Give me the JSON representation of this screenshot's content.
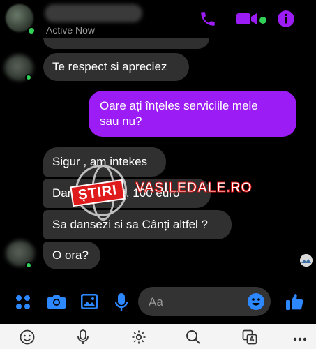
{
  "header": {
    "status": "Active Now",
    "online_color": "#31d158",
    "accent_color": "#9b1cf5",
    "icons": [
      "phone-icon",
      "video-icon",
      "info-icon"
    ]
  },
  "messages": [
    {
      "direction": "in",
      "text": "Te respect si apreciez"
    },
    {
      "direction": "out",
      "text": "Oare ați înțeles serviciile mele sau nu?"
    },
    {
      "direction": "in",
      "text": "Sigur , am intekes"
    },
    {
      "direction": "in",
      "text": "Dansu... ...ofe, 100 euro"
    },
    {
      "direction": "in",
      "text": "Sa dansezi si sa Cânți altfel ?"
    },
    {
      "direction": "in",
      "text": "O ora?"
    }
  ],
  "watermark": {
    "badge": "ȘTIRI",
    "site": "VASILEDALE.RO",
    "badge_color": "#e01b1b"
  },
  "composer": {
    "placeholder": "Aa",
    "icons": [
      "apps-icon",
      "camera-icon",
      "gallery-icon",
      "microphone-icon",
      "emoji-icon",
      "thumbs-up-icon"
    ]
  },
  "keyboard_toolbar": {
    "icons": [
      "emoji-keyboard-icon",
      "voice-input-icon",
      "settings-icon",
      "search-icon",
      "translate-icon",
      "more-icon"
    ]
  }
}
